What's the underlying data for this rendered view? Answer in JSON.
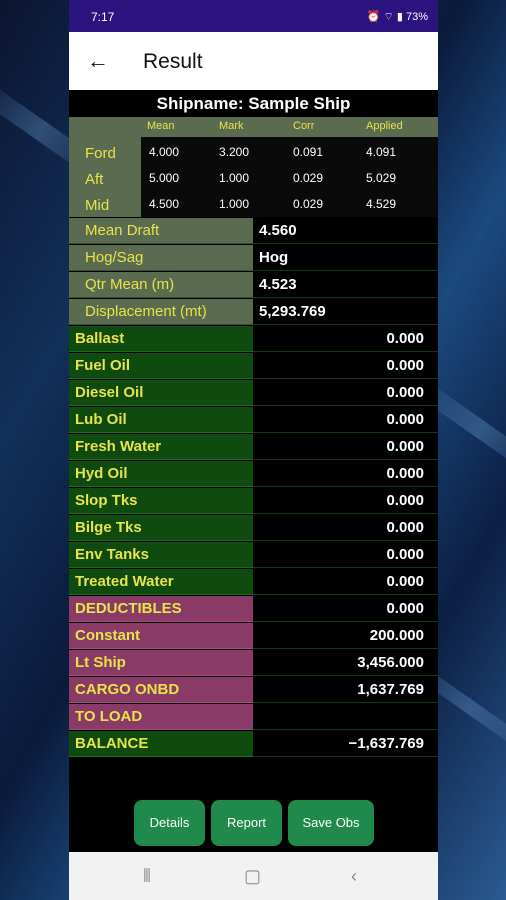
{
  "status": {
    "time": "7:17",
    "icons": "⏰ ⌔ ▮ 73%"
  },
  "appbar": {
    "title": "Result"
  },
  "ship": {
    "label": "Shipname:",
    "name": "Sample Ship"
  },
  "draft": {
    "headers": [
      "Mean",
      "Mark",
      "Corr",
      "Applied"
    ],
    "rows": [
      {
        "label": "Ford",
        "values": [
          "4.000",
          "3.200",
          "0.091",
          "4.091"
        ]
      },
      {
        "label": "Aft",
        "values": [
          "5.000",
          "1.000",
          "0.029",
          "5.029"
        ]
      },
      {
        "label": "Mid",
        "values": [
          "4.500",
          "1.000",
          "0.029",
          "4.529"
        ]
      }
    ]
  },
  "summary": [
    {
      "label": "Mean Draft",
      "value": "4.560"
    },
    {
      "label": "Hog/Sag",
      "value": "Hog"
    },
    {
      "label": "Qtr Mean (m)",
      "value": "4.523"
    },
    {
      "label": "Displacement (mt)",
      "value": "5,293.769"
    }
  ],
  "consumables": [
    {
      "label": "Ballast",
      "value": "0.000"
    },
    {
      "label": "Fuel Oil",
      "value": "0.000"
    },
    {
      "label": "Diesel Oil",
      "value": "0.000"
    },
    {
      "label": "Lub Oil",
      "value": "0.000"
    },
    {
      "label": "Fresh Water",
      "value": "0.000"
    },
    {
      "label": "Hyd Oil",
      "value": "0.000"
    },
    {
      "label": "Slop Tks",
      "value": "0.000"
    },
    {
      "label": "Bilge Tks",
      "value": "0.000"
    },
    {
      "label": "Env Tanks",
      "value": "0.000"
    },
    {
      "label": "Treated Water",
      "value": "0.000"
    }
  ],
  "totals": [
    {
      "label": "DEDUCTIBLES",
      "value": "0.000"
    },
    {
      "label": "Constant",
      "value": "200.000"
    },
    {
      "label": "Lt Ship",
      "value": "3,456.000"
    },
    {
      "label": "CARGO ONBD",
      "value": "1,637.769"
    },
    {
      "label": "TO LOAD",
      "value": ""
    }
  ],
  "balance": {
    "label": "BALANCE",
    "value": "−1,637.769"
  },
  "buttons": {
    "details": "Details",
    "report": "Report",
    "save": "Save Obs"
  },
  "colors": {
    "status_bar": "#2b1380",
    "label_grey": "#5a6b4f",
    "label_green": "#0f4a0f",
    "label_pink": "#8a3a66",
    "label_text": "#e8e34a",
    "button": "#1f8a4c"
  }
}
